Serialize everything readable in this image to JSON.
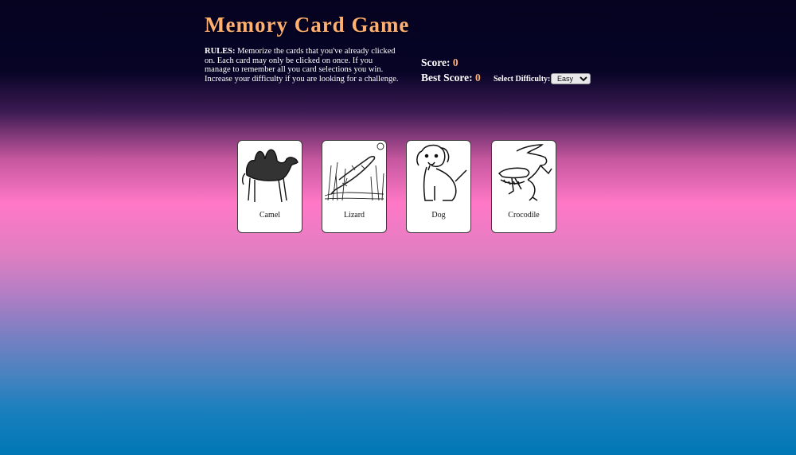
{
  "header": {
    "title": "Memory Card Game",
    "rules_label": "RULES:",
    "rules_text": " Memorize the cards that you've already clicked on. Each card may only be clicked on once. If you manage to remember all you card selections you win. Increase your difficulty if you are looking for a challenge."
  },
  "scoreboard": {
    "score_label": "Score:",
    "score_value": "0",
    "best_label": "Best Score:",
    "best_value": "0"
  },
  "difficulty": {
    "label": "Select Difficulty:",
    "selected": "Easy"
  },
  "cards": [
    {
      "label": "Camel",
      "icon": "camel-icon"
    },
    {
      "label": "Lizard",
      "icon": "lizard-icon"
    },
    {
      "label": "Dog",
      "icon": "dog-icon"
    },
    {
      "label": "Crocodile",
      "icon": "crocodile-icon"
    }
  ],
  "colors": {
    "accent": "#ffb070",
    "card_bg": "#ffffff"
  }
}
